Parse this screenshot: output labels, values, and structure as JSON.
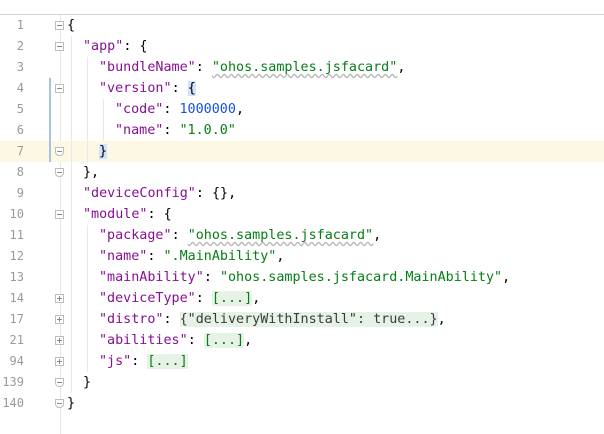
{
  "lines": [
    {
      "num": "1",
      "tokens": [
        {
          "t": "p",
          "v": "{"
        }
      ]
    },
    {
      "num": "2",
      "tokens": [
        {
          "t": "k",
          "v": "\"app\""
        },
        {
          "t": "p",
          "v": ": {"
        }
      ]
    },
    {
      "num": "3",
      "tokens": [
        {
          "t": "k",
          "v": "\"bundleName\""
        },
        {
          "t": "p",
          "v": ": "
        },
        {
          "t": "s",
          "v": "\"ohos.samples.jsfacard\""
        },
        {
          "t": "p",
          "v": ","
        }
      ]
    },
    {
      "num": "4",
      "tokens": [
        {
          "t": "k",
          "v": "\"version\""
        },
        {
          "t": "p",
          "v": ": "
        },
        {
          "t": "hl",
          "v": "{"
        }
      ]
    },
    {
      "num": "5",
      "tokens": [
        {
          "t": "k",
          "v": "\"code\""
        },
        {
          "t": "p",
          "v": ": "
        },
        {
          "t": "n",
          "v": "1000000"
        },
        {
          "t": "p",
          "v": ","
        }
      ]
    },
    {
      "num": "6",
      "tokens": [
        {
          "t": "k",
          "v": "\"name\""
        },
        {
          "t": "p",
          "v": ": "
        },
        {
          "t": "s",
          "v": "\"1.0.0\""
        }
      ]
    },
    {
      "num": "7",
      "tokens": [
        {
          "t": "hl",
          "v": "}"
        }
      ]
    },
    {
      "num": "8",
      "tokens": [
        {
          "t": "p",
          "v": "},"
        }
      ]
    },
    {
      "num": "9",
      "tokens": [
        {
          "t": "k",
          "v": "\"deviceConfig\""
        },
        {
          "t": "p",
          "v": ": {},"
        }
      ]
    },
    {
      "num": "10",
      "tokens": [
        {
          "t": "k",
          "v": "\"module\""
        },
        {
          "t": "p",
          "v": ": {"
        }
      ]
    },
    {
      "num": "11",
      "tokens": [
        {
          "t": "k",
          "v": "\"package\""
        },
        {
          "t": "p",
          "v": ": "
        },
        {
          "t": "s",
          "v": "\"ohos.samples.jsfacard\""
        },
        {
          "t": "p",
          "v": ","
        }
      ]
    },
    {
      "num": "12",
      "tokens": [
        {
          "t": "k",
          "v": "\"name\""
        },
        {
          "t": "p",
          "v": ": "
        },
        {
          "t": "s",
          "v": "\".MainAbility\""
        },
        {
          "t": "p",
          "v": ","
        }
      ]
    },
    {
      "num": "13",
      "tokens": [
        {
          "t": "k",
          "v": "\"mainAbility\""
        },
        {
          "t": "p",
          "v": ": "
        },
        {
          "t": "s",
          "v": "\"ohos.samples.jsfacard.MainAbility\""
        },
        {
          "t": "p",
          "v": ","
        }
      ]
    },
    {
      "num": "14",
      "tokens": [
        {
          "t": "k",
          "v": "\"deviceType\""
        },
        {
          "t": "p",
          "v": ": "
        },
        {
          "t": "folded",
          "v": "[...]"
        },
        {
          "t": "p",
          "v": ","
        }
      ]
    },
    {
      "num": "17",
      "tokens": [
        {
          "t": "k",
          "v": "\"distro\""
        },
        {
          "t": "p",
          "v": ": "
        },
        {
          "t": "foldedplain",
          "v": "{\"deliveryWithInstall\": true...}"
        },
        {
          "t": "p",
          "v": ","
        }
      ]
    },
    {
      "num": "21",
      "tokens": [
        {
          "t": "k",
          "v": "\"abilities\""
        },
        {
          "t": "p",
          "v": ": "
        },
        {
          "t": "folded",
          "v": "[...]"
        },
        {
          "t": "p",
          "v": ","
        }
      ]
    },
    {
      "num": "94",
      "tokens": [
        {
          "t": "k",
          "v": "\"js\""
        },
        {
          "t": "p",
          "v": ": "
        },
        {
          "t": "folded",
          "v": "[...]"
        }
      ]
    },
    {
      "num": "139",
      "tokens": [
        {
          "t": "p",
          "v": "}"
        }
      ]
    },
    {
      "num": "140",
      "tokens": [
        {
          "t": "p",
          "v": "}"
        }
      ]
    }
  ]
}
